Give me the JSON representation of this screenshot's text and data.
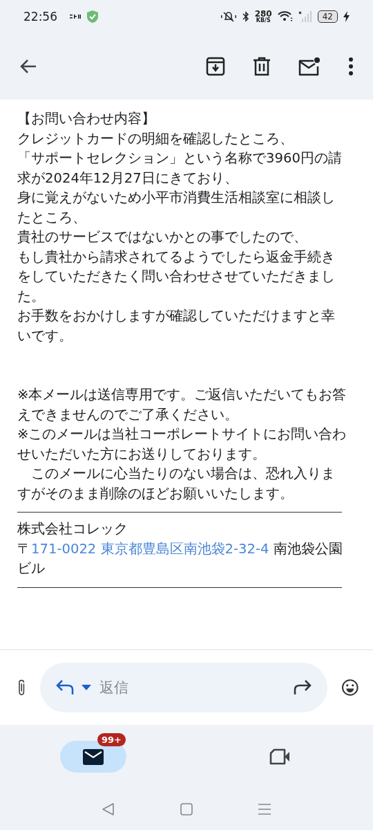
{
  "status_bar": {
    "time": "22:56",
    "speed_value": "280",
    "speed_unit": "KB/S",
    "battery": "42"
  },
  "message": {
    "heading": "【お問い合わせ内容】",
    "lines": [
      "クレジットカードの明細を確認したところ、",
      "「サポートセレクション」という名称で3960円の請求が2024年12月27日にきており、",
      "身に覚えがないため小平市消費生活相談室に相談したところ、",
      "貴社のサービスではないかとの事でしたので、",
      "もし貴社から請求されてるようでしたら返金手続きをしていただきたく問い合わせさせていただきました。",
      "お手数をおかけしますが確認していただけますと幸いです。"
    ],
    "notes": [
      "※本メールは送信専用です。ご返信いただいてもお答えできませんのでご了承ください。",
      "※このメールは当社コーポレートサイトにお問い合わせいただいた方にお送りしております。",
      "　このメールに心当たりのない場合は、恐れ入りますがそのまま削除のほどお願いいたします。"
    ],
    "signature": {
      "company": "株式会社コレック",
      "address_prefix": "〒",
      "address_link": "171-0022 東京都豊島区南池袋2-32-4",
      "address_suffix": " 南池袋公園ビル"
    }
  },
  "reply": {
    "placeholder": "返信"
  },
  "bottom_nav": [
    {
      "kind": "mail",
      "selected": true,
      "badge": "99+"
    },
    {
      "kind": "video",
      "selected": false
    }
  ]
}
